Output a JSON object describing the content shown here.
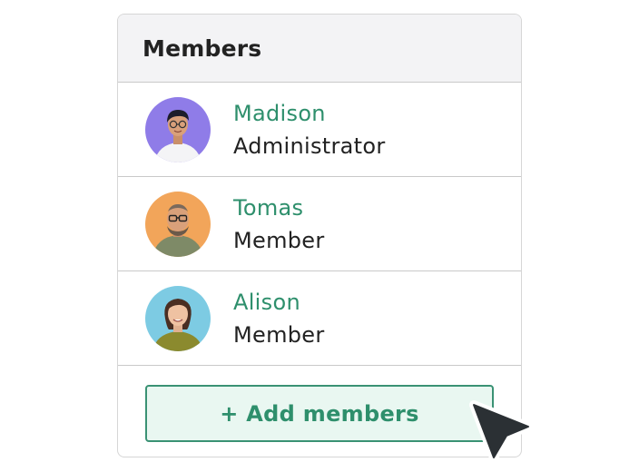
{
  "panel": {
    "title": "Members"
  },
  "members": [
    {
      "name": "Madison",
      "role": "Administrator",
      "avatar_bg": "#8f7ce8"
    },
    {
      "name": "Tomas",
      "role": "Member",
      "avatar_bg": "#f2a55a"
    },
    {
      "name": "Alison",
      "role": "Member",
      "avatar_bg": "#7dcbe3"
    }
  ],
  "actions": {
    "add_label": "+ Add members"
  },
  "colors": {
    "accent": "#2e8f6c",
    "button_bg": "#e9f7f1",
    "header_bg": "#f3f3f5"
  },
  "icons": {
    "cursor": "mouse-pointer-icon"
  }
}
